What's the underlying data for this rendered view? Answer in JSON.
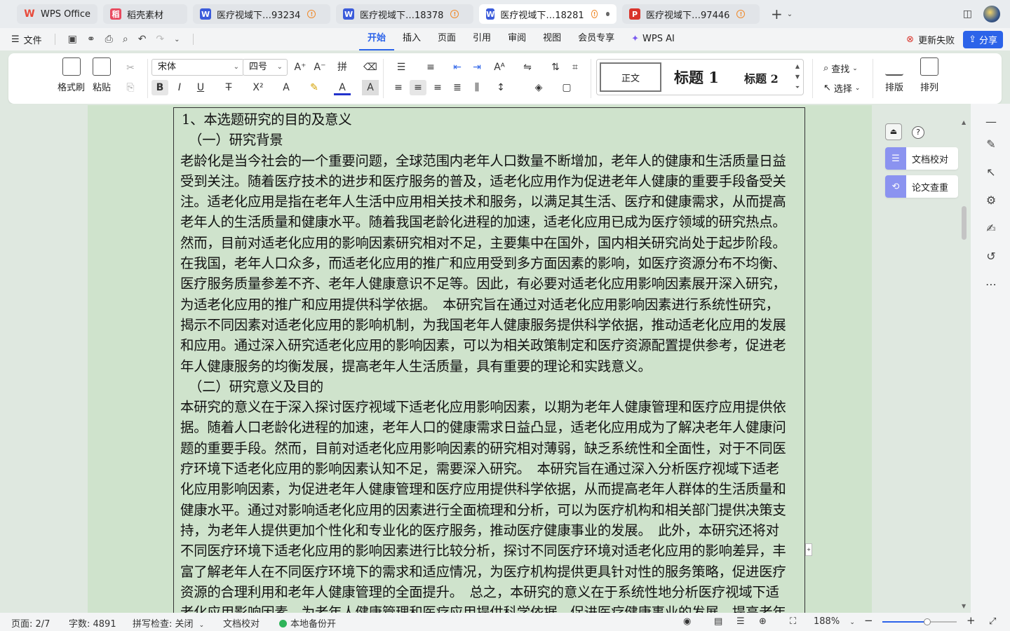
{
  "tabs": [
    {
      "label": "WPS Office",
      "icon": "wps-logo-icon",
      "color": "#e84a3a"
    },
    {
      "label": "稻壳素材",
      "icon": "docer-icon",
      "color": "#e84a5f"
    },
    {
      "label": "医疗视域下…93234",
      "icon": "writer-doc-icon",
      "color": "#3b5bdb"
    },
    {
      "label": "医疗视域下…18378",
      "icon": "writer-doc-icon",
      "color": "#3b5bdb"
    },
    {
      "label": "医疗视域下…18281",
      "icon": "writer-doc-icon",
      "color": "#3b5bdb"
    },
    {
      "label": "医疗视域下…97446",
      "icon": "pdf-icon",
      "color": "#d9342b"
    }
  ],
  "menu": {
    "file_label": "文件",
    "tabs": [
      "开始",
      "插入",
      "页面",
      "引用",
      "审阅",
      "视图",
      "会员专享",
      "WPS AI"
    ],
    "update_fail": "更新失败",
    "share": "分享"
  },
  "ribbon": {
    "format_painter": "格式刷",
    "paste": "粘贴",
    "font_name": "宋体",
    "font_size": "四号",
    "style_normal": "正文",
    "style_h1": "标题 1",
    "style_h2": "标题 2",
    "find": "查找",
    "select": "选择",
    "layout": "排版",
    "arrange": "排列"
  },
  "document": {
    "lines": [
      "1、本选题研究的目的及意义",
      "（一）研究背景",
      "老龄化是当今社会的一个重要问题，全球范围内老年人口数量不断增加，老年人的健康和生活质量日益",
      "受到关注。随着医疗技术的进步和医疗服务的普及，适老化应用作为促进老年人健康的重要手段备受关",
      "注。适老化应用是指在老年人生活中应用相关技术和服务，以满足其生活、医疗和健康需求，从而提高",
      "老年人的生活质量和健康水平。随着我国老龄化进程的加速，适老化应用已成为医疗领域的研究热点。",
      "然而，目前对适老化应用的影响因素研究相对不足，主要集中在国外，国内相关研究尚处于起步阶段。",
      "在我国，老年人口众多，而适老化应用的推广和应用受到多方面因素的影响，如医疗资源分布不均衡、",
      "医疗服务质量参差不齐、老年人健康意识不足等。因此，有必要对适老化应用影响因素展开深入研究，",
      "为适老化应用的推广和应用提供科学依据。　本研究旨在通过对适老化应用影响因素进行系统性研究，",
      "揭示不同因素对适老化应用的影响机制，为我国老年人健康服务提供科学依据，推动适老化应用的发展",
      "和应用。通过深入研究适老化应用的影响因素，可以为相关政策制定和医疗资源配置提供参考，促进老",
      "年人健康服务的均衡发展，提高老年人生活质量，具有重要的理论和实践意义。",
      "（二）研究意义及目的",
      "本研究的意义在于深入探讨医疗视域下适老化应用影响因素，以期为老年人健康管理和医疗应用提供依",
      "据。随着人口老龄化进程的加速，老年人口的健康需求日益凸显，适老化应用成为了解决老年人健康问",
      "题的重要手段。然而，目前对适老化应用影响因素的研究相对薄弱，缺乏系统性和全面性，对于不同医",
      "疗环境下适老化应用的影响因素认知不足，需要深入研究。　本研究旨在通过深入分析医疗视域下适老",
      "化应用影响因素，为促进老年人健康管理和医疗应用提供科学依据，从而提高老年人群体的生活质量和",
      "健康水平。通过对影响适老化应用的因素进行全面梳理和分析，可以为医疗机构和相关部门提供决策支",
      "持，为老年人提供更加个性化和专业化的医疗服务，推动医疗健康事业的发展。　此外，本研究还将对",
      "不同医疗环境下适老化应用的影响因素进行比较分析，探讨不同医疗环境对适老化应用的影响差异，丰",
      "富了解老年人在不同医疗环境下的需求和适应情况，为医疗机构提供更具针对性的服务策略，促进医疗",
      "资源的合理利用和老年人健康管理的全面提升。　总之，本研究的意义在于系统性地分析医疗视域下适",
      "老化应用影响因素，为老年人健康管理和医疗应用提供科学依据，促进医疗健康事业的发展，提高老年"
    ]
  },
  "side_panel": {
    "proofread": "文档校对",
    "plagiarism": "论文查重"
  },
  "status": {
    "page": "页面: 2/7",
    "words": "字数: 4891",
    "spell": "拼写检查: 关闭",
    "proof": "文档校对",
    "backup": "本地备份开",
    "zoom": "188%",
    "zoom_fraction": 0.6
  },
  "colors": {
    "accent": "#2c63e9",
    "page_bg": "#cfe3cc",
    "backup_dot": "#2fb45a"
  }
}
